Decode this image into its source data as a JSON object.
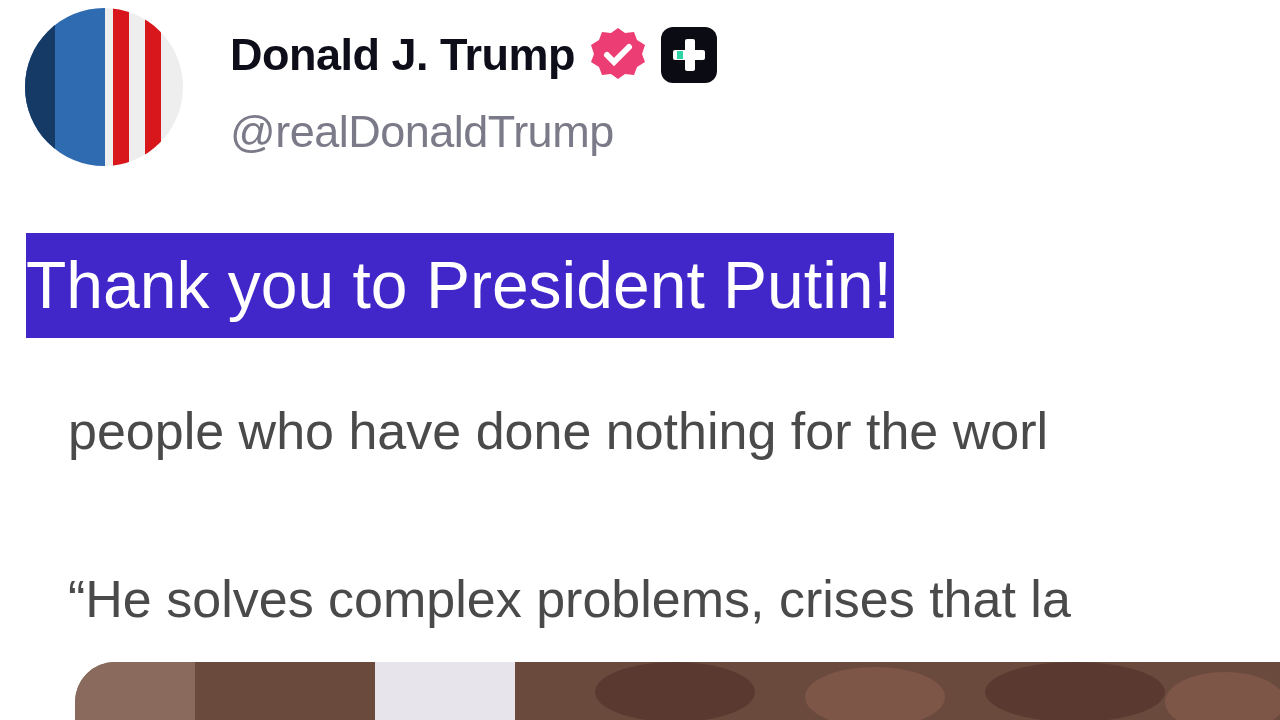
{
  "author": {
    "name": "Donald J. Trump",
    "verified": true,
    "handle": "@realDonaldTrump"
  },
  "post": {
    "text": "Thank you to President Putin!",
    "selected": true
  },
  "quote": {
    "lines": [
      "people who have done nothing for the worl",
      "“He solves complex problems, crises that la"
    ]
  }
}
